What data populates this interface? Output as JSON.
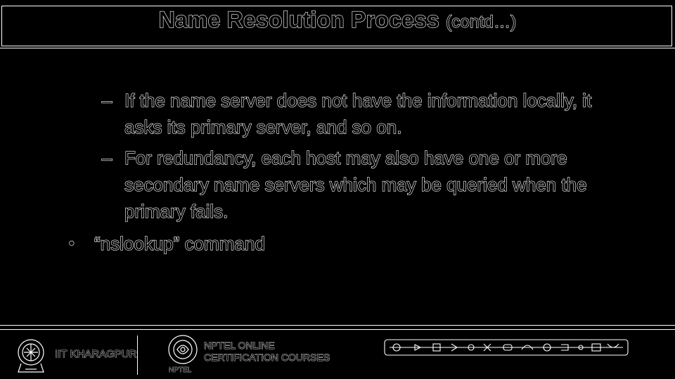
{
  "slide": {
    "title": "Name Resolution Process",
    "title_suffix": "(contd…)"
  },
  "content": {
    "dash_items": [
      {
        "marker": "–",
        "text": "If the name server does not have the information locally, it asks its primary server, and so on."
      },
      {
        "marker": "–",
        "text": "For redundancy, each host may also have one or more secondary name servers which may be queried when the primary fails."
      }
    ],
    "bullet_items": [
      {
        "marker": "•",
        "text": "“nslookup” command"
      }
    ]
  },
  "footer": {
    "institute": "IIT KHARAGPUR",
    "nptel_line1": "NPTEL ONLINE",
    "nptel_line2": "CERTIFICATION COURSES",
    "nptel_small": "NPTEL"
  },
  "colors": {
    "background": "#000000",
    "outline": "#ffffff"
  }
}
